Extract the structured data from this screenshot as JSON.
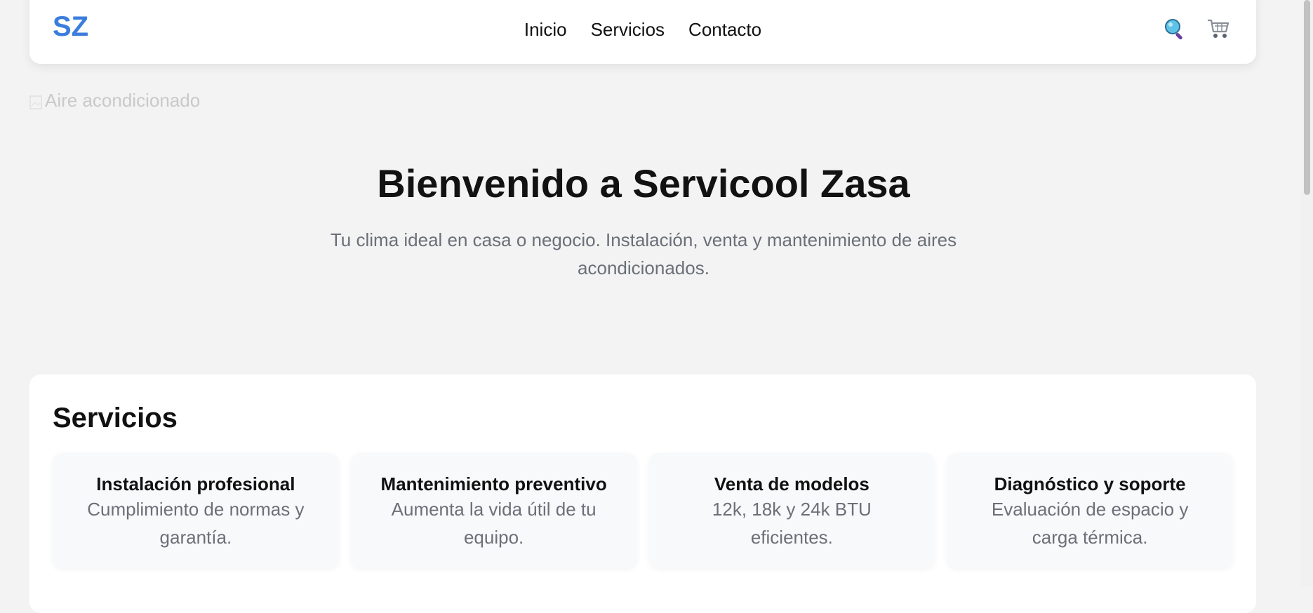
{
  "header": {
    "logo": "SZ",
    "nav": [
      {
        "label": "Inicio"
      },
      {
        "label": "Servicios"
      },
      {
        "label": "Contacto"
      }
    ],
    "icons": [
      "search-icon",
      "cart-icon"
    ]
  },
  "hero": {
    "image_alt": "Aire acondicionado",
    "title": "Bienvenido a Servicool Zasa",
    "subtitle": "Tu clima ideal en casa o negocio. Instalación, venta y mantenimiento de aires acondicionados."
  },
  "services": {
    "title": "Servicios",
    "items": [
      {
        "title": "Instalación profesional",
        "desc": "Cumplimiento de normas y garantía."
      },
      {
        "title": "Mantenimiento preventivo",
        "desc": "Aumenta la vida útil de tu equipo."
      },
      {
        "title": "Venta de modelos",
        "desc": "12k, 18k y 24k BTU eficientes."
      },
      {
        "title": "Diagnóstico y soporte",
        "desc": "Evaluación de espacio y carga térmica."
      }
    ]
  },
  "colors": {
    "brand": "#3b7ddd",
    "background": "#f3f3f3",
    "card": "#ffffff",
    "muted_text": "#6b6f78"
  }
}
